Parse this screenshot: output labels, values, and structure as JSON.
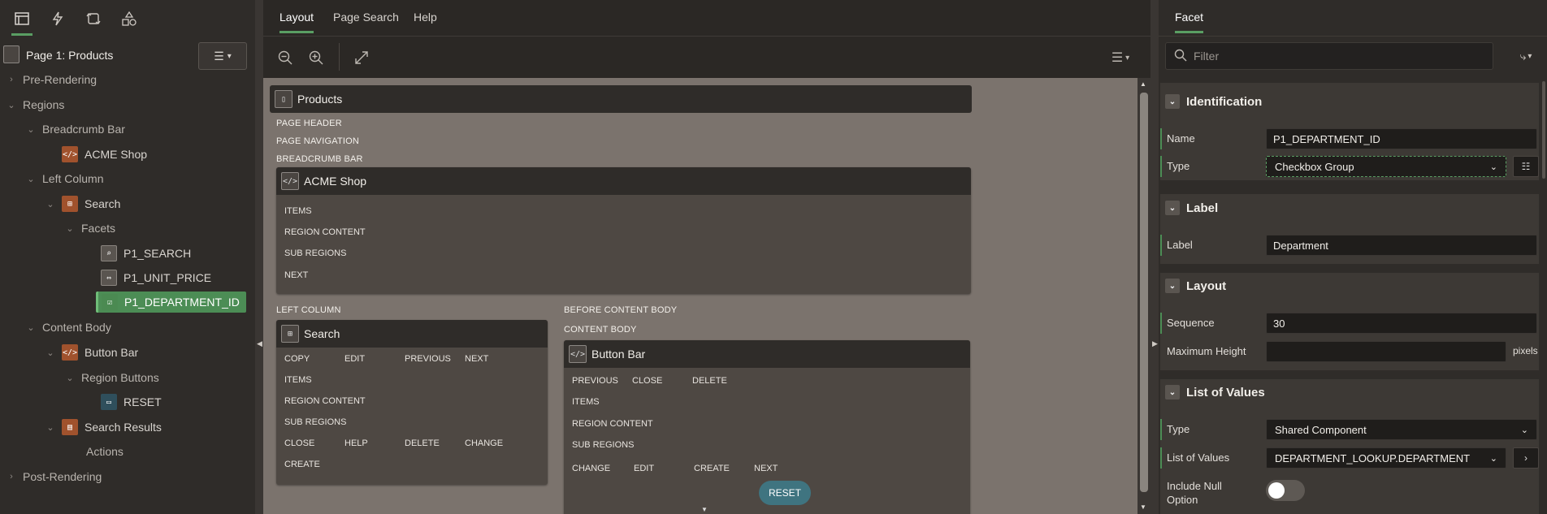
{
  "left": {
    "title": "Page 1: Products",
    "tree": [
      {
        "label": "Pre-Rendering"
      },
      {
        "label": "Regions"
      },
      {
        "label": "Breadcrumb Bar"
      },
      {
        "label": "ACME Shop"
      },
      {
        "label": "Left Column"
      },
      {
        "label": "Search"
      },
      {
        "label": "Facets"
      },
      {
        "label": "P1_SEARCH"
      },
      {
        "label": "P1_UNIT_PRICE"
      },
      {
        "label": "P1_DEPARTMENT_ID"
      },
      {
        "label": "Content Body"
      },
      {
        "label": "Button Bar"
      },
      {
        "label": "Region Buttons"
      },
      {
        "label": "RESET"
      },
      {
        "label": "Search Results"
      },
      {
        "label": "Actions"
      },
      {
        "label": "Post-Rendering"
      }
    ]
  },
  "center": {
    "tabs": [
      {
        "label": "Layout"
      },
      {
        "label": "Page Search"
      },
      {
        "label": "Help"
      }
    ],
    "page_region": "Products",
    "slots": {
      "page_header": "PAGE HEADER",
      "page_navigation": "PAGE NAVIGATION",
      "breadcrumb_bar": "BREADCRUMB BAR",
      "left_column": "LEFT COLUMN",
      "before_content_body": "BEFORE CONTENT BODY",
      "content_body": "CONTENT BODY"
    },
    "acme": {
      "title": "ACME Shop",
      "rows": [
        "ITEMS",
        "REGION CONTENT",
        "SUB REGIONS",
        "NEXT"
      ]
    },
    "search": {
      "title": "Search",
      "top": [
        "COPY",
        "EDIT",
        "PREVIOUS",
        "NEXT"
      ],
      "rows": [
        "ITEMS",
        "REGION CONTENT",
        "SUB REGIONS"
      ],
      "bottom": [
        "CLOSE",
        "HELP",
        "DELETE",
        "CHANGE"
      ],
      "create": "CREATE"
    },
    "buttonbar": {
      "title": "Button Bar",
      "top": [
        "PREVIOUS",
        "CLOSE",
        "DELETE"
      ],
      "rows": [
        "ITEMS",
        "REGION CONTENT",
        "SUB REGIONS"
      ],
      "bottom": [
        "CHANGE",
        "EDIT",
        "CREATE",
        "NEXT"
      ],
      "reset": "RESET"
    }
  },
  "right": {
    "tab": "Facet",
    "filter_placeholder": "Filter",
    "sections": {
      "identification": "Identification",
      "label": "Label",
      "layout": "Layout",
      "lov": "List of Values"
    },
    "props": {
      "name_label": "Name",
      "name_value": "P1_DEPARTMENT_ID",
      "type_label": "Type",
      "type_value": "Checkbox Group",
      "label_label": "Label",
      "label_value": "Department",
      "sequence_label": "Sequence",
      "sequence_value": "30",
      "maxheight_label": "Maximum Height",
      "maxheight_value": "",
      "maxheight_unit": "pixels",
      "lovtype_label": "Type",
      "lovtype_value": "Shared Component",
      "lov_label": "List of Values",
      "lov_value": "DEPARTMENT_LOOKUP.DEPARTMENT",
      "includenull_label_1": "Include Null",
      "includenull_label_2": "Option",
      "includenull_value": false
    }
  },
  "colors": {
    "accent": "#5a9e63",
    "selected": "#4c8d55",
    "reset": "#3f7480"
  }
}
